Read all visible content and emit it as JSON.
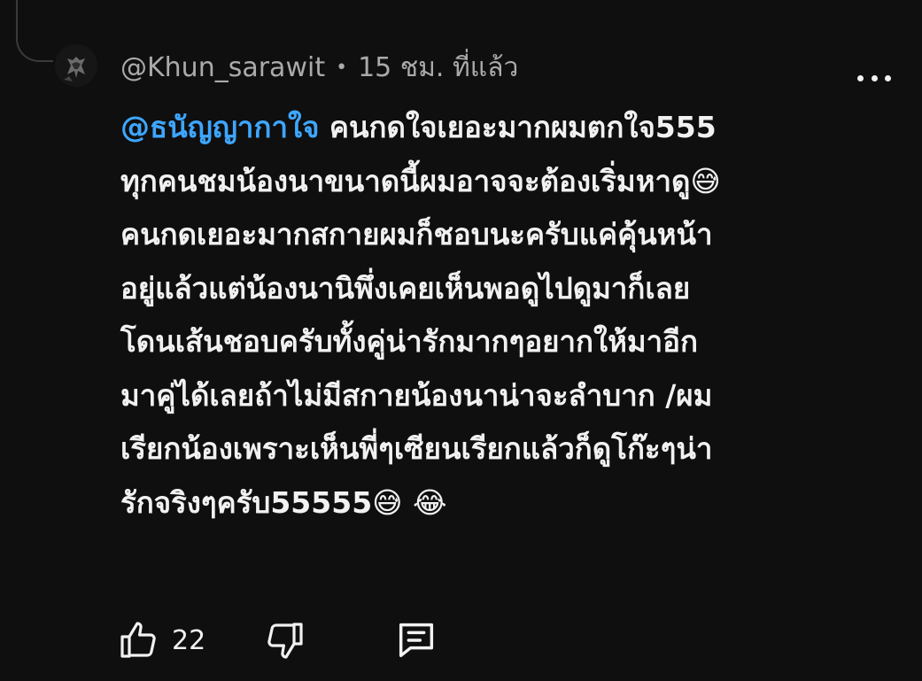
{
  "comment": {
    "author": "@Khun_sarawit",
    "separator": "•",
    "time": "15 ชม. ที่แล้ว",
    "mention": "@ธนัญญากาใจ",
    "lines": [
      " คนกดใจเยอะมากผมตกใจ555",
      "ทุกคนชมน้องนาขนาดนี้ผมอาจจะต้องเริ่มหาดู😅",
      "คนกดเยอะมากสกายผมก็ชอบนะครับแค่คุ้นหน้า",
      "อยู่แล้วแต่น้องนานิพึ่งเคยเห็นพอดูไปดูมาก็เลย",
      "โดนเส้นชอบครับทั้งคู่น่ารักมากๆอยากให้มาอีก",
      "มาคู่ได้เลยถ้าไม่มีสกายน้องนาน่าจะลำบาก /ผม",
      "เรียกน้องเพราะเห็นพี่ๆเซียนเรียกแล้วก็ดูโก๊ะๆน่า",
      "รักจริงๆครับ55555😅 😂"
    ]
  },
  "actions": {
    "like_count": "22",
    "like_icon": "thumb-up-icon",
    "dislike_icon": "thumb-down-icon",
    "reply_icon": "comment-icon",
    "more_icon": "more-horizontal-icon"
  },
  "colors": {
    "background": "#0f0f0f",
    "text": "#f1f1f1",
    "meta": "#aaaaaa",
    "mention": "#3ea6ff"
  }
}
